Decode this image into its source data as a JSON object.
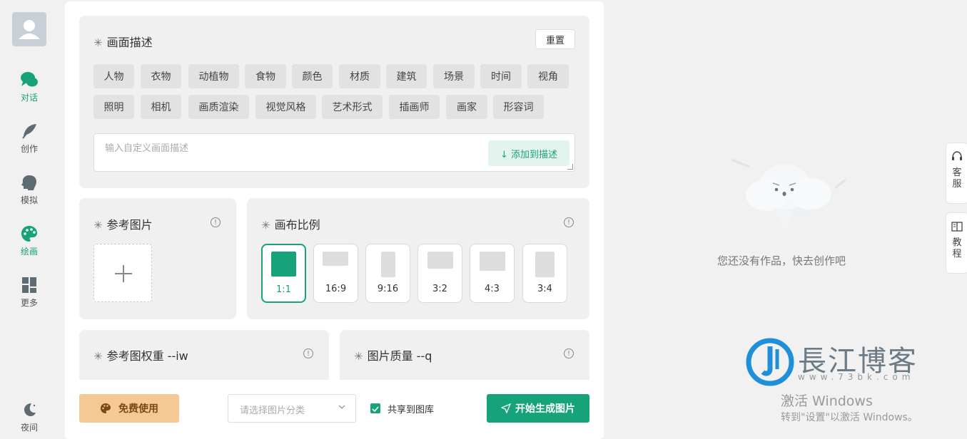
{
  "sidebar": {
    "items": [
      {
        "label": "对话",
        "icon": "chat-bubbles-icon",
        "active": true
      },
      {
        "label": "创作",
        "icon": "feather-icon",
        "active": false
      },
      {
        "label": "模拟",
        "icon": "head-profile-icon",
        "active": false
      },
      {
        "label": "绘画",
        "icon": "palette-icon",
        "active": true
      },
      {
        "label": "更多",
        "icon": "grid-icon",
        "active": false
      }
    ],
    "night": {
      "label": "夜间",
      "icon": "moon-icon"
    }
  },
  "description": {
    "title": "画面描述",
    "reset_label": "重置",
    "tags_row1": [
      "人物",
      "衣物",
      "动植物",
      "食物",
      "颜色",
      "材质",
      "建筑",
      "场景",
      "时间",
      "视角"
    ],
    "tags_row2": [
      "照明",
      "相机",
      "画质渲染",
      "视觉风格",
      "艺术形式",
      "插画师",
      "画家",
      "形容词"
    ],
    "input_placeholder": "输入自定义画面描述",
    "add_label": "↓ 添加到描述"
  },
  "reference": {
    "title": "参考图片"
  },
  "canvas": {
    "title": "画布比例",
    "selected": "1:1",
    "ratios": [
      "1:1",
      "16:9",
      "9:16",
      "3:2",
      "4:3",
      "3:4"
    ]
  },
  "weight": {
    "title": "参考图权重 --iw"
  },
  "quality": {
    "title": "图片质量 --q"
  },
  "bottom": {
    "free_label": "免费使用",
    "category_placeholder": "请选择图片分类",
    "share_label": "共享到图库",
    "share_checked": true,
    "generate_label": "开始生成图片"
  },
  "right": {
    "empty_text": "您还没有作品，快去创作吧",
    "tabs": [
      {
        "label": "客服",
        "icon": "headset-icon"
      },
      {
        "label": "教程",
        "icon": "book-icon"
      }
    ]
  },
  "watermark": {
    "brand": "長江博客",
    "url": "www.73bk.com"
  },
  "activation": {
    "title": "激活 Windows",
    "subtitle": "转到\"设置\"以激活 Windows。"
  },
  "colors": {
    "accent": "#17a37a",
    "free_button": "#f6c994"
  }
}
